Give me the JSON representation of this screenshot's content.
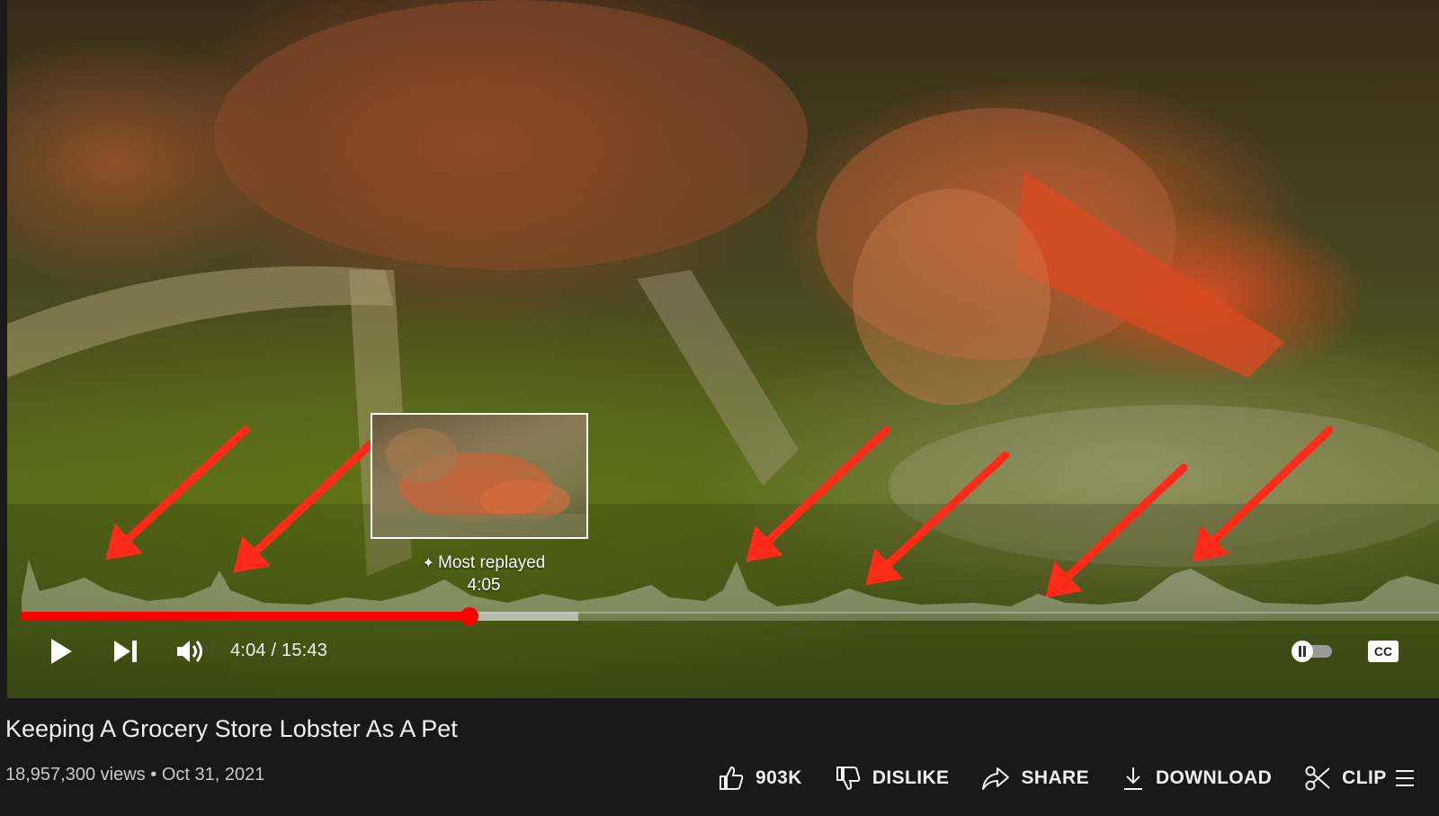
{
  "video": {
    "title": "Keeping A Grocery Store Lobster As A Pet",
    "views": "18,957,300 views",
    "date": "Oct 31, 2021",
    "separator": "•"
  },
  "player": {
    "current_time": "4:04",
    "duration": "15:43",
    "time_separator": " / ",
    "progress_played": 0.316,
    "progress_buffered": 0.393,
    "most_replayed_label": "Most replayed",
    "most_replayed_time": "4:05",
    "accent_color": "#ff0000",
    "icons": [
      "play-icon",
      "next-icon",
      "volume-icon",
      "autoplay-toggle-icon",
      "closed-captions-icon",
      "sparkle-icon"
    ],
    "cc_label": "CC"
  },
  "actions": [
    {
      "id": "like",
      "label": "903K",
      "icon": "thumbs-up-icon"
    },
    {
      "id": "dislike",
      "label": "DISLIKE",
      "icon": "thumbs-down-icon"
    },
    {
      "id": "share",
      "label": "SHARE",
      "icon": "share-icon"
    },
    {
      "id": "download",
      "label": "DOWNLOAD",
      "icon": "download-icon"
    },
    {
      "id": "clip",
      "label": "CLIP",
      "icon": "scissors-icon"
    }
  ],
  "annotation": {
    "arrow_color": "#ff2a1a",
    "arrow_count": 7
  }
}
